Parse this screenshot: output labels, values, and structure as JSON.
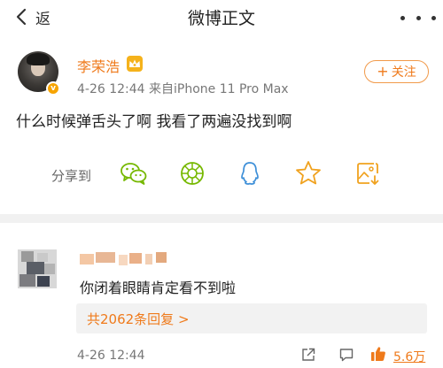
{
  "header": {
    "back_label": "返",
    "title": "微博正文"
  },
  "post": {
    "author": "李荣浩",
    "meta": "4-26 12:44  来自iPhone 11 Pro Max",
    "follow_label": "关注",
    "text": "什么时候弹舌头了啊 我看了两遍没找到啊"
  },
  "share": {
    "label": "分享到",
    "targets": [
      "wechat-icon",
      "moments-icon",
      "qq-icon",
      "star-icon",
      "save-image-icon"
    ]
  },
  "comment": {
    "text": "你闭着眼睛肯定看不到啦",
    "replies_label": "共2062条回复 >",
    "time": "4-26 12:44",
    "likes": "5.6万"
  },
  "colors": {
    "accent": "#ef7a1b",
    "icon_green": "#76b800",
    "icon_blue": "#3d8fd8",
    "icon_orange": "#f0a21f"
  }
}
